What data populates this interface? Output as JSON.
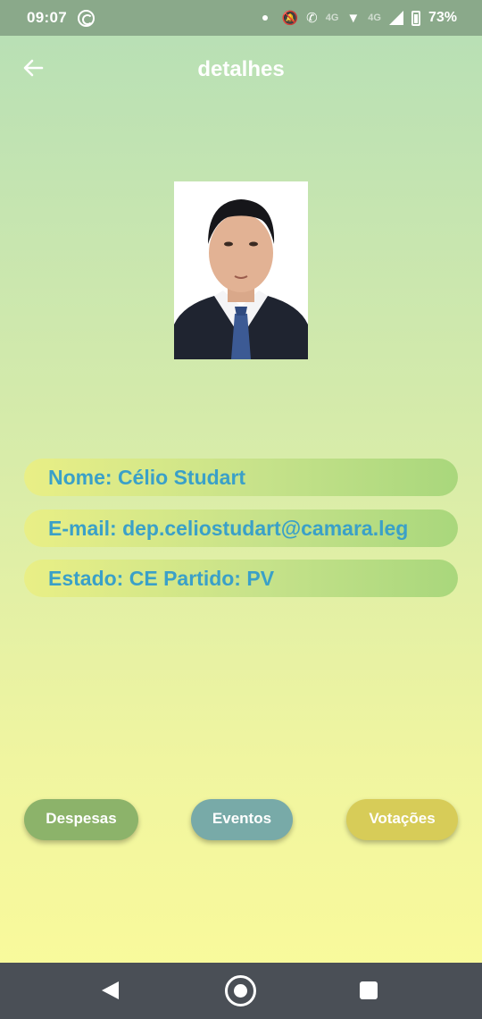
{
  "status_bar": {
    "time": "09:07",
    "network_label": "4G",
    "network_label_2": "4G",
    "battery": "73%"
  },
  "app_bar": {
    "title": "detalhes"
  },
  "details": {
    "nome": "Nome: Célio Studart",
    "email": "E-mail: dep.celiostudart@camara.leg",
    "estado_partido": "Estado: CE  Partido: PV"
  },
  "actions": {
    "despesas": "Despesas",
    "eventos": "Eventos",
    "votacoes": "Votações"
  },
  "colors": {
    "text_accent": "#3aa0c8",
    "despesas_button": "#8cb36a",
    "eventos_button": "#78aaa8",
    "votacoes_button": "#d7cc58"
  }
}
